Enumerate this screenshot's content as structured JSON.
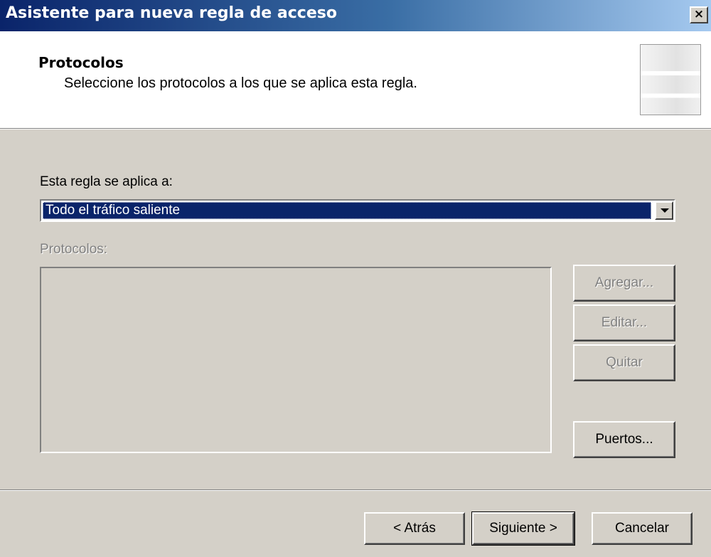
{
  "window": {
    "title": "Asistente para nueva regla de acceso",
    "close_label": "×"
  },
  "header": {
    "title": "Protocolos",
    "subtitle": "Seleccione los protocolos a los que se aplica esta regla."
  },
  "rule_applies": {
    "label": "Esta regla se aplica a:",
    "selected_value": "Todo el tráfico saliente"
  },
  "protocols": {
    "label": "Protocolos:",
    "items": []
  },
  "side_buttons": {
    "add": "Agregar...",
    "edit": "Editar...",
    "remove": "Quitar",
    "ports": "Puertos..."
  },
  "footer": {
    "back": "< Atrás",
    "next": "Siguiente >",
    "cancel": "Cancelar"
  },
  "icons": {
    "close": "close-icon",
    "dropdown": "chevron-down-icon",
    "header_image": "wizard-header-image"
  }
}
